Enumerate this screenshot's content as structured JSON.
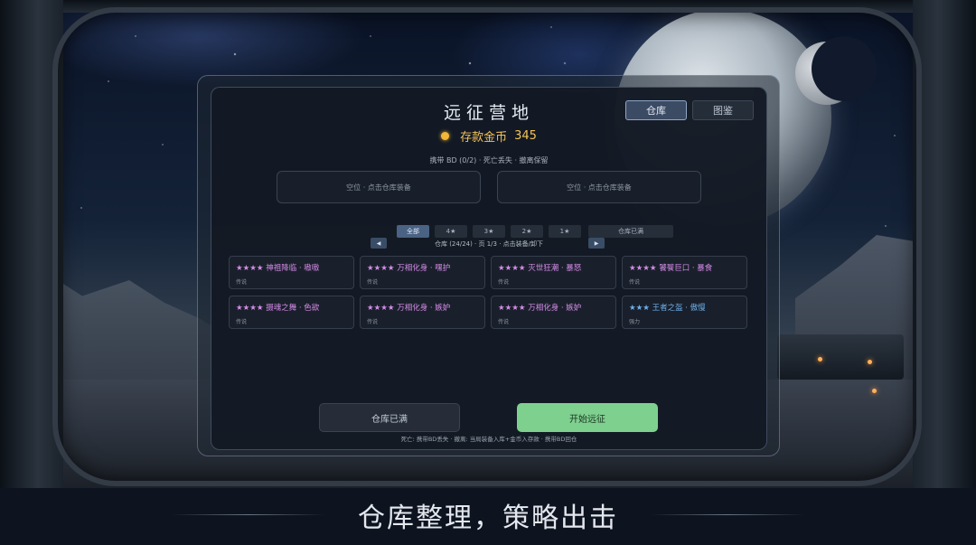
{
  "header": {
    "title": "远征营地",
    "tabs": [
      {
        "label": "仓库",
        "active": true
      },
      {
        "label": "图鉴",
        "active": false
      }
    ],
    "coins_label": "存款金币",
    "coins_value": "345"
  },
  "carry": {
    "info": "携带 BD (0/2) · 死亡丢失 · 撤离保留",
    "slots": [
      "空位 · 点击仓库装备",
      "空位 · 点击仓库装备"
    ]
  },
  "filters": {
    "items": [
      {
        "label": "全部",
        "active": true
      },
      {
        "label": "4★",
        "active": false
      },
      {
        "label": "3★",
        "active": false
      },
      {
        "label": "2★",
        "active": false
      },
      {
        "label": "1★",
        "active": false
      }
    ],
    "sorted_label": "仓库已满"
  },
  "pagination": {
    "info": "仓库 (24/24) · 页 1/3 · 点击装备/卸下",
    "prev_icon": "chevron-left-icon",
    "next_icon": "chevron-right-icon"
  },
  "items": [
    {
      "stars": "★★★★",
      "name": "神祖降临 · 嗷嗷",
      "rarity": "传说",
      "color": "#d58be8"
    },
    {
      "stars": "★★★★",
      "name": "万相化身 · 嘿护",
      "rarity": "传说",
      "color": "#d58be8"
    },
    {
      "stars": "★★★★",
      "name": "灭世狂潮 · 暴怒",
      "rarity": "传说",
      "color": "#d58be8"
    },
    {
      "stars": "★★★★",
      "name": "饕餮巨口 · 暴食",
      "rarity": "传说",
      "color": "#d58be8"
    },
    {
      "stars": "★★★★",
      "name": "摄魂之舞 · 色欲",
      "rarity": "传说",
      "color": "#d58be8"
    },
    {
      "stars": "★★★★",
      "name": "万相化身 · 嫉妒",
      "rarity": "传说",
      "color": "#d58be8"
    },
    {
      "stars": "★★★★",
      "name": "万相化身 · 嫉妒",
      "rarity": "传说",
      "color": "#d58be8"
    },
    {
      "stars": "★★★",
      "name": "王者之盔 · 傲慢",
      "rarity": "强力",
      "color": "#6fb0ea"
    }
  ],
  "actions": {
    "full_label": "仓库已满",
    "start_label": "开始远征",
    "footnote": "死亡: 携带BD丢失 · 撤离: 当局装备入库+金币入存款 · 携带BD回仓"
  },
  "caption": "仓库整理，策略出击",
  "colors": {
    "coin": "#f2c35a",
    "start_button": "#7ed08e",
    "legend_item": "#d58be8",
    "epic_item": "#6fb0ea"
  }
}
